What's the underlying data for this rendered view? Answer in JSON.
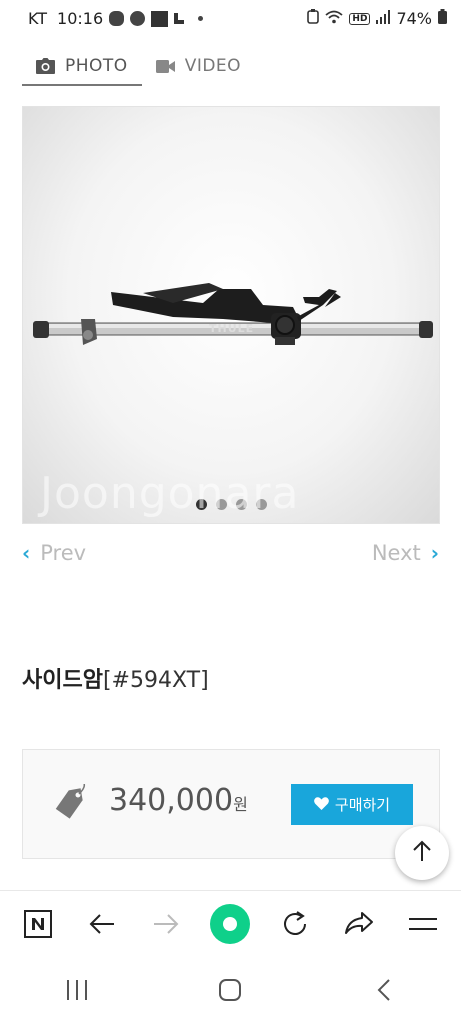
{
  "status_bar": {
    "carrier": "KT",
    "time": "10:16",
    "left_icons": [
      "talk-icon",
      "c-icon",
      "vpn-icon",
      "notification-icon"
    ],
    "right_icons": [
      "alarm-icon",
      "wifi-icon",
      "hd-icon",
      "signal-icon",
      "battery-icon"
    ],
    "hd_label": "HD",
    "battery": "74%"
  },
  "media_tabs": [
    {
      "label": "PHOTO",
      "icon": "camera-icon",
      "active": true
    },
    {
      "label": "VIDEO",
      "icon": "video-camera-icon",
      "active": false
    }
  ],
  "gallery": {
    "watermark": "Joongonara",
    "brand_label": "THULE",
    "slide_count": 4,
    "active_slide": 1
  },
  "pager": {
    "prev_label": "Prev",
    "next_label": "Next"
  },
  "product": {
    "name": "사이드암",
    "code": "[#594XT]",
    "price": "340,000",
    "currency": "원",
    "buy_label": "구매하기"
  },
  "browser_toolbar": {
    "items": [
      "naver-home-icon",
      "back-arrow-icon",
      "forward-arrow-icon",
      "green-dot-icon",
      "refresh-icon",
      "share-icon",
      "menu-icon"
    ]
  },
  "android_nav": {
    "items": [
      "recent-apps-icon",
      "home-icon",
      "back-icon"
    ]
  }
}
